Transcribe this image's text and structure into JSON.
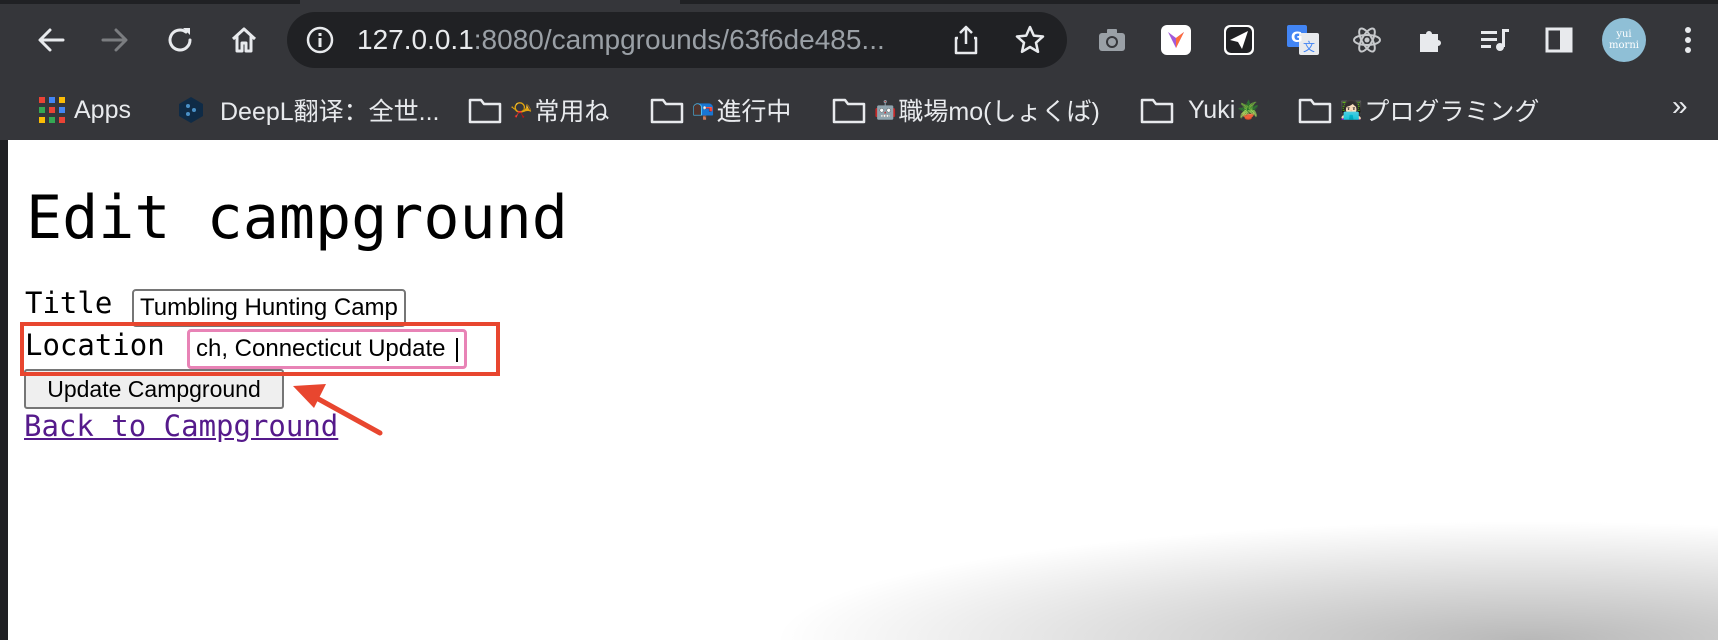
{
  "browser": {
    "url_host": "127.0.0.1",
    "url_rest": ":8080/campgrounds/63f6de485...",
    "avatar_text": "yui morni",
    "bookmarks": [
      {
        "label": "Apps",
        "icon": "apps-grid-icon"
      },
      {
        "label": "DeepL翻译：全世...",
        "icon": "deepl-icon"
      },
      {
        "label": "常用ね",
        "icon": "folder-icon",
        "emoji": "📯"
      },
      {
        "label": "進行中",
        "icon": "folder-icon",
        "emoji": "📭"
      },
      {
        "label": "職場mo(しょくば)",
        "icon": "folder-icon",
        "emoji": "🤖"
      },
      {
        "label": "Yuki",
        "icon": "folder-icon",
        "emoji": "🪴"
      },
      {
        "label": "プログラミング",
        "icon": "folder-icon",
        "emoji": "👩🏻‍💻"
      }
    ],
    "more_label": "»",
    "extensions": [
      "camera-icon",
      "download-extension-icon",
      "send-icon",
      "translate-icon",
      "react-icon",
      "puzzle-icon",
      "reading-list-icon",
      "side-panel-icon"
    ]
  },
  "page": {
    "title": "Edit campground",
    "title_label": "Title",
    "title_value": "Tumbling Hunting Camp",
    "location_label": "Location",
    "location_value": "ch, Connecticut Update",
    "submit_label": "Update Campground",
    "back_link": "Back to Campground"
  },
  "annotation": {
    "color": "#e8462f"
  }
}
